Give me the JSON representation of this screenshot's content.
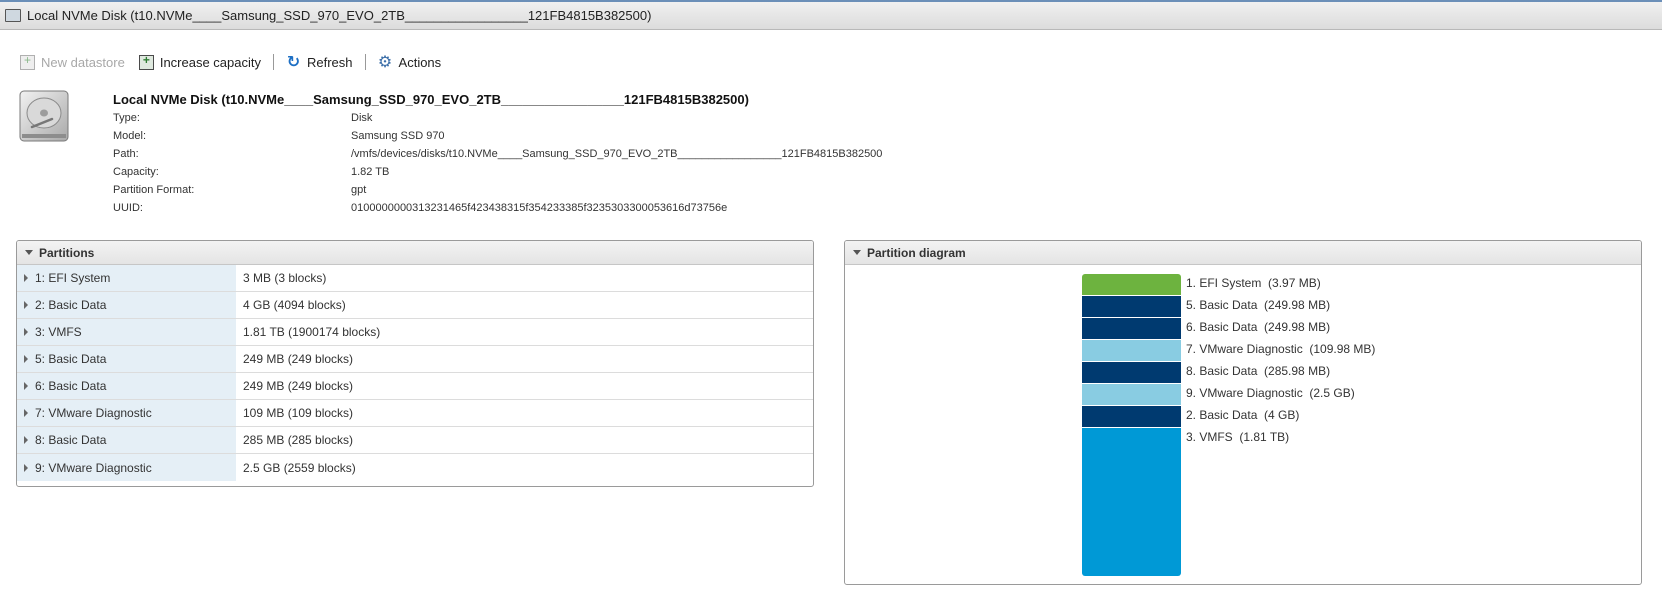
{
  "window": {
    "title": "Local NVMe Disk (t10.NVMe____Samsung_SSD_970_EVO_2TB_________________121FB4815B382500)"
  },
  "toolbar": {
    "new_datastore": "New datastore",
    "increase_capacity": "Increase capacity",
    "refresh": "Refresh",
    "actions": "Actions"
  },
  "disk": {
    "title": "Local NVMe Disk (t10.NVMe____Samsung_SSD_970_EVO_2TB_________________121FB4815B382500)",
    "fields": [
      {
        "label": "Type:",
        "value": "Disk"
      },
      {
        "label": "Model:",
        "value": "Samsung SSD 970"
      },
      {
        "label": "Path:",
        "value": "/vmfs/devices/disks/t10.NVMe____Samsung_SSD_970_EVO_2TB_________________121FB4815B382500"
      },
      {
        "label": "Capacity:",
        "value": "1.82 TB"
      },
      {
        "label": "Partition Format:",
        "value": "gpt"
      },
      {
        "label": "UUID:",
        "value": "0100000000313231465f423438315f354233385f3235303300053616d73756e"
      }
    ]
  },
  "partitions": {
    "title": "Partitions",
    "rows": [
      {
        "name": "1: EFI System",
        "size": "3 MB (3 blocks)"
      },
      {
        "name": "2: Basic Data",
        "size": "4 GB (4094 blocks)"
      },
      {
        "name": "3: VMFS",
        "size": "1.81 TB (1900174 blocks)"
      },
      {
        "name": "5: Basic Data",
        "size": "249 MB (249 blocks)"
      },
      {
        "name": "6: Basic Data",
        "size": "249 MB (249 blocks)"
      },
      {
        "name": "7: VMware Diagnostic",
        "size": "109 MB (109 blocks)"
      },
      {
        "name": "8: Basic Data",
        "size": "285 MB (285 blocks)"
      },
      {
        "name": "9: VMware Diagnostic",
        "size": "2.5 GB (2559 blocks)"
      }
    ]
  },
  "diagram": {
    "title": "Partition diagram",
    "segments": [
      {
        "label": "1. EFI System  (3.97 MB)",
        "color": "#6db33f",
        "share": 0.072
      },
      {
        "label": "5. Basic Data  (249.98 MB)",
        "color": "#003a70",
        "share": 0.072
      },
      {
        "label": "6. Basic Data  (249.98 MB)",
        "color": "#003a70",
        "share": 0.072
      },
      {
        "label": "7. VMware Diagnostic  (109.98 MB)",
        "color": "#89cce2",
        "share": 0.072
      },
      {
        "label": "8. Basic Data  (285.98 MB)",
        "color": "#003a70",
        "share": 0.072
      },
      {
        "label": "9. VMware Diagnostic  (2.5 GB)",
        "color": "#89cce2",
        "share": 0.072
      },
      {
        "label": "2. Basic Data  (4 GB)",
        "color": "#003a70",
        "share": 0.072
      },
      {
        "label": "3. VMFS  (1.81 TB)",
        "color": "#0099d6",
        "share": 0.496
      }
    ]
  }
}
